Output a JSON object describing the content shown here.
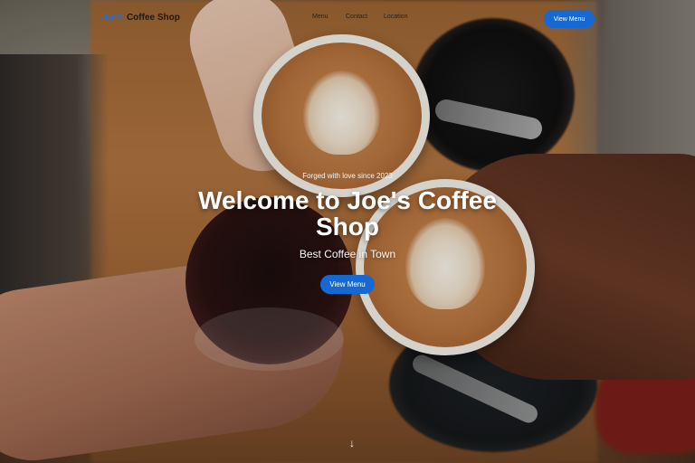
{
  "nav": {
    "brand_accent": "Joe's",
    "brand_rest": "Coffee Shop",
    "links": [
      "Menu",
      "Contact",
      "Location"
    ],
    "cta_label": "View Menu"
  },
  "hero": {
    "tagline": "Forged with love since 2023",
    "title": "Welcome to Joe's Coffee Shop",
    "subtitle": "Best Coffee in Town",
    "cta_label": "View Menu",
    "scroll_icon": "↓"
  },
  "colors": {
    "accent": "#1a73d9",
    "button": "#1668d2"
  },
  "icons": {
    "scroll": "arrow-down-icon"
  }
}
